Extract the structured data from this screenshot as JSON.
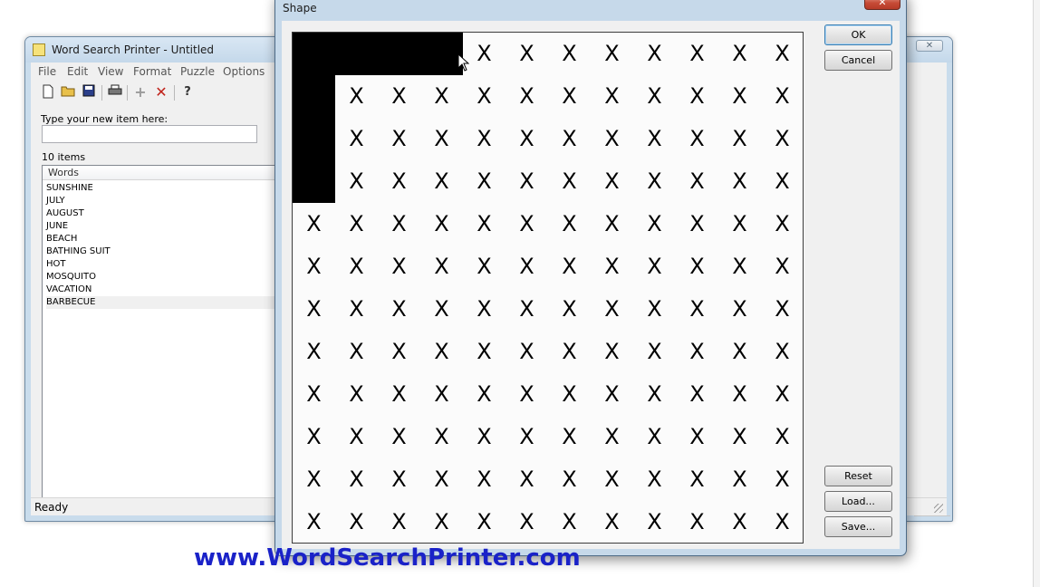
{
  "main_window": {
    "title": "Word Search Printer - Untitled",
    "menu": [
      "File",
      "Edit",
      "View",
      "Format",
      "Puzzle",
      "Options"
    ],
    "toolbar_icons": [
      "new-file-icon",
      "open-folder-icon",
      "save-disk-icon",
      "print-icon",
      "add-plus-icon",
      "delete-x-icon",
      "help-icon"
    ],
    "new_item_label": "Type your new item here:",
    "new_item_value": "",
    "item_count": "10 items",
    "list_header": "Words",
    "words": [
      "SUNSHINE",
      "JULY",
      "AUGUST",
      "JUNE",
      "BEACH",
      "BATHING SUIT",
      "HOT",
      "MOSQUITO",
      "VACATION",
      "BARBECUE"
    ],
    "status": "Ready",
    "close_symbol": "✕"
  },
  "dialog": {
    "title": "Shape",
    "close_symbol": "✕",
    "ok_label": "OK",
    "cancel_label": "Cancel",
    "reset_label": "Reset",
    "load_label": "Load...",
    "save_label": "Save...",
    "grid": {
      "rows": 12,
      "cols": 12,
      "cell_mark": "X",
      "filled_cells": [
        [
          0,
          0
        ],
        [
          0,
          1
        ],
        [
          0,
          2
        ],
        [
          0,
          3
        ],
        [
          1,
          0
        ],
        [
          2,
          0
        ],
        [
          3,
          0
        ]
      ]
    }
  },
  "watermark": "www.WordSearchPrinter.com"
}
